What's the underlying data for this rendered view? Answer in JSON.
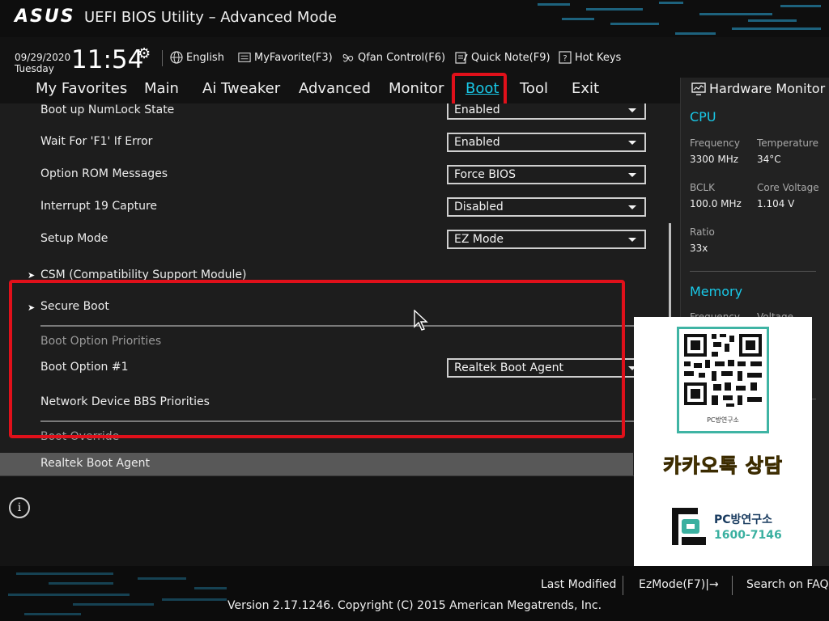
{
  "header": {
    "brand": "ASUS",
    "title": "UEFI BIOS Utility – Advanced Mode",
    "date": "09/29/2020",
    "day": "Tuesday",
    "time": "11:54",
    "tools": [
      {
        "label": "English",
        "icon": "globe-icon"
      },
      {
        "label": "MyFavorite(F3)",
        "icon": "favorite-icon"
      },
      {
        "label": "Qfan Control(F6)",
        "icon": "fan-icon"
      },
      {
        "label": "Quick Note(F9)",
        "icon": "note-icon"
      },
      {
        "label": "Hot Keys",
        "icon": "hotkeys-icon"
      }
    ]
  },
  "tabs": [
    "My Favorites",
    "Main",
    "Ai Tweaker",
    "Advanced",
    "Monitor",
    "Boot",
    "Tool",
    "Exit"
  ],
  "active_tab": "Boot",
  "settings": [
    {
      "label": "Boot up NumLock State",
      "value": "Enabled"
    },
    {
      "label": "Wait For 'F1' If Error",
      "value": "Enabled"
    },
    {
      "label": "Option ROM Messages",
      "value": "Force BIOS"
    },
    {
      "label": "Interrupt 19 Capture",
      "value": "Disabled"
    },
    {
      "label": "Setup Mode",
      "value": "EZ Mode"
    }
  ],
  "submenus": {
    "csm": "CSM (Compatibility Support Module)",
    "secure_boot": "Secure Boot"
  },
  "boot_priorities": {
    "header": "Boot Option Priorities",
    "option1_label": "Boot Option #1",
    "option1_value": "Realtek Boot Agent",
    "network_bbs": "Network Device BBS Priorities"
  },
  "boot_override": {
    "header": "Boot Override",
    "item": "Realtek Boot Agent"
  },
  "hardware_monitor": {
    "title": "Hardware Monitor",
    "cpu": {
      "section": "CPU",
      "frequency_label": "Frequency",
      "frequency": "3300 MHz",
      "temperature_label": "Temperature",
      "temperature": "34°C",
      "bclk_label": "BCLK",
      "bclk": "100.0 MHz",
      "core_voltage_label": "Core Voltage",
      "core_voltage": "1.104 V",
      "ratio_label": "Ratio",
      "ratio": "33x"
    },
    "memory": {
      "section": "Memory",
      "frequency_label": "Frequency",
      "voltage_label": "Voltage"
    }
  },
  "ad": {
    "qr_caption": "PC방연구소",
    "kakao": "카카오톡 상담",
    "brand_name": "PC방연구소",
    "phone": "1600-7146"
  },
  "footer": {
    "last_modified": "Last Modified",
    "ezmode": "EzMode(F7)|→",
    "search_faq": "Search on FAQ",
    "copyright": "Version 2.17.1246. Copyright (C) 2015 American Megatrends, Inc."
  },
  "colors": {
    "accent": "#19c9e8",
    "highlight": "#e0101a",
    "ad_yellow": "#f4c400",
    "ad_teal": "#3ab0a0"
  }
}
